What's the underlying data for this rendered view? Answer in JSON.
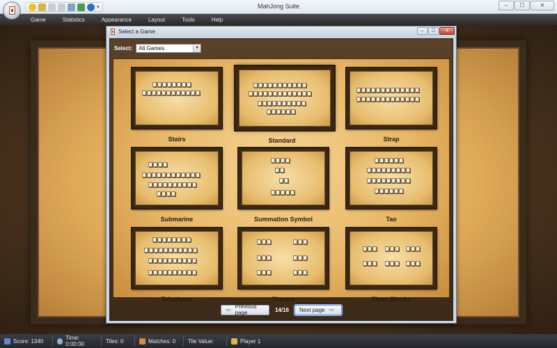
{
  "app": {
    "window_title": "MahJong Suite"
  },
  "menu": [
    "Game",
    "Statistics",
    "Appearance",
    "Layout",
    "Tools",
    "Help"
  ],
  "window_controls": {
    "minimize": "–",
    "maximize": "☐",
    "close": "✕"
  },
  "dialog": {
    "title": "Select a Game",
    "select_label": "Select:",
    "select_value": "All Games",
    "games": [
      {
        "name": "Stairs",
        "selected": false
      },
      {
        "name": "Standard",
        "selected": true
      },
      {
        "name": "Strap",
        "selected": false
      },
      {
        "name": "Submarine",
        "selected": false
      },
      {
        "name": "Summation Symbol",
        "selected": false
      },
      {
        "name": "Tao",
        "selected": false
      },
      {
        "name": "Telephone",
        "selected": false
      },
      {
        "name": "Theatre",
        "selected": false
      },
      {
        "name": "Three Blocks",
        "selected": false
      }
    ],
    "previous_label": "Previous page",
    "next_label": "Next page",
    "page_indicator": "14/16",
    "controls": {
      "minimize": "–",
      "maximize": "☐",
      "close": "✕"
    }
  },
  "status": {
    "score": "Score: 1340",
    "time": "Time: 0:00:00",
    "tiles": "Tiles: 0",
    "matches": "Matches: 0",
    "tile_value": "Tile Value:",
    "player": "Player 1"
  },
  "colors": {
    "accent_blue": "#4c8fd6",
    "wood_dark": "#3b2a19",
    "parchment": "#e8b767"
  }
}
